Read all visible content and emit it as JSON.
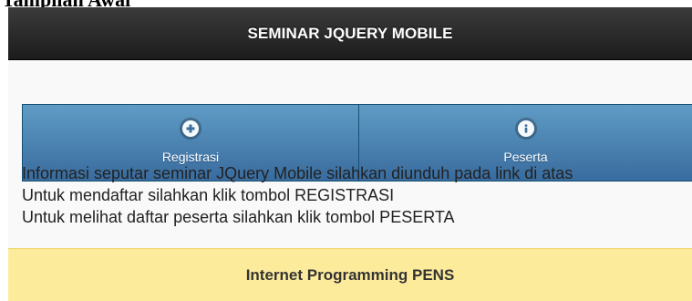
{
  "document_caption": "Tampilan Awal",
  "header": {
    "title": "SEMINAR JQUERY MOBILE"
  },
  "navbar": {
    "items": [
      {
        "label": "Registrasi",
        "icon": "plus-icon"
      },
      {
        "label": "Peserta",
        "icon": "info-icon"
      }
    ]
  },
  "content": {
    "lines": [
      "Informasi seputar seminar JQuery Mobile silahkan diunduh pada link di atas",
      "Untuk mendaftar silahkan klik tombol REGISTRASI",
      "Untuk melihat daftar peserta silahkan klik tombol PESERTA"
    ]
  },
  "footer": {
    "title": "Internet Programming PENS"
  },
  "colors": {
    "header_bg": "#2a2a2a",
    "navbar_bg": "#4a84b5",
    "footer_bg": "#fdeb9c",
    "content_bg": "#f9f9f9"
  }
}
